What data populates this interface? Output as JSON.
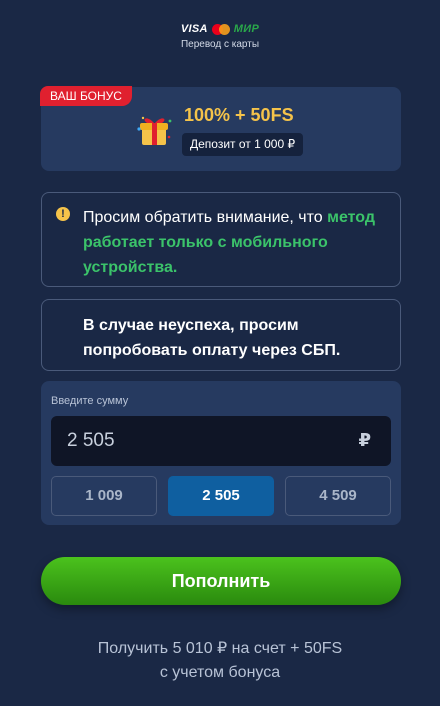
{
  "header": {
    "logo_visa": "VISA",
    "logo_mir": "МИР",
    "subtitle": "Перевод с карты"
  },
  "bonus": {
    "badge": "ВАШ БОНУС",
    "title": "100% + 50FS",
    "deposit": "Депозит от 1 000 ₽",
    "icon": "gift-icon"
  },
  "notices": {
    "first_prefix": "Просим обратить внимание, что ",
    "first_highlight": "метод работает только с мобильного устройства.",
    "second": "В случае неуспеха, просим попробовать оплату через СБП."
  },
  "amount": {
    "label": "Введите сумму",
    "value": "2 505",
    "currency": "₽",
    "presets": [
      "1 009",
      "2 505",
      "4 509"
    ],
    "active_preset": "2 505"
  },
  "submit_label": "Пополнить",
  "footer": {
    "line1": "Получить 5 010 ₽ на счет + 50FS",
    "line2": "с учетом бонуса"
  },
  "colors": {
    "background": "#1a2845",
    "card": "#263a60",
    "accent_green": "#3bc36a",
    "bonus_gold": "#f5c34a",
    "badge_red": "#e0202f",
    "active_blue": "#0f5fa0"
  }
}
